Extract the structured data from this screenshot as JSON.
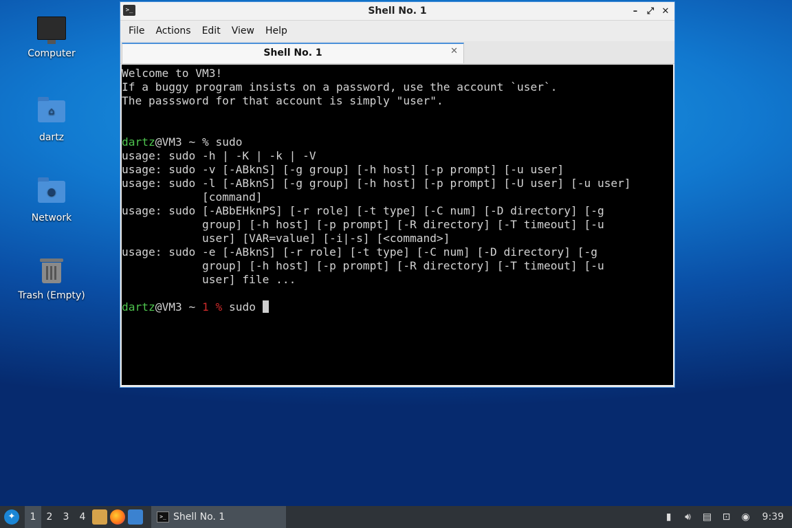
{
  "desktop": {
    "icons": [
      {
        "label": "Computer"
      },
      {
        "label": "dartz"
      },
      {
        "label": "Network"
      },
      {
        "label": "Trash (Empty)"
      }
    ]
  },
  "window": {
    "title": "Shell No. 1",
    "menu": [
      "File",
      "Actions",
      "Edit",
      "View",
      "Help"
    ],
    "tab": {
      "label": "Shell No. 1"
    }
  },
  "terminal": {
    "welcome_lines": [
      "Welcome to VM3!",
      "If a buggy program insists on a password, use the account `user`.",
      "The passsword for that account is simply \"user\"."
    ],
    "prompt1": {
      "user": "dartz",
      "host": "@VM3 ~ % ",
      "command": "sudo"
    },
    "output_lines": [
      "usage: sudo -h | -K | -k | -V",
      "usage: sudo -v [-ABknS] [-g group] [-h host] [-p prompt] [-u user]",
      "usage: sudo -l [-ABknS] [-g group] [-h host] [-p prompt] [-U user] [-u user]",
      "            [command]",
      "usage: sudo [-ABbEHknPS] [-r role] [-t type] [-C num] [-D directory] [-g",
      "            group] [-h host] [-p prompt] [-R directory] [-T timeout] [-u",
      "            user] [VAR=value] [-i|-s] [<command>]",
      "usage: sudo -e [-ABknS] [-r role] [-t type] [-C num] [-D directory] [-g",
      "            group] [-h host] [-p prompt] [-R directory] [-T timeout] [-u",
      "            user] file ..."
    ],
    "prompt2": {
      "user": "dartz",
      "host": "@VM3 ~ ",
      "status": "1 %",
      "command": " sudo "
    }
  },
  "taskbar": {
    "workspaces": [
      "1",
      "2",
      "3",
      "4"
    ],
    "active_task": "Shell No. 1",
    "clock": "9:39"
  },
  "colors": {
    "accent": "#4a90d9",
    "prompt_user": "#4ec44e",
    "prompt_status": "#cc2a2a",
    "terminal_bg": "#000000"
  }
}
